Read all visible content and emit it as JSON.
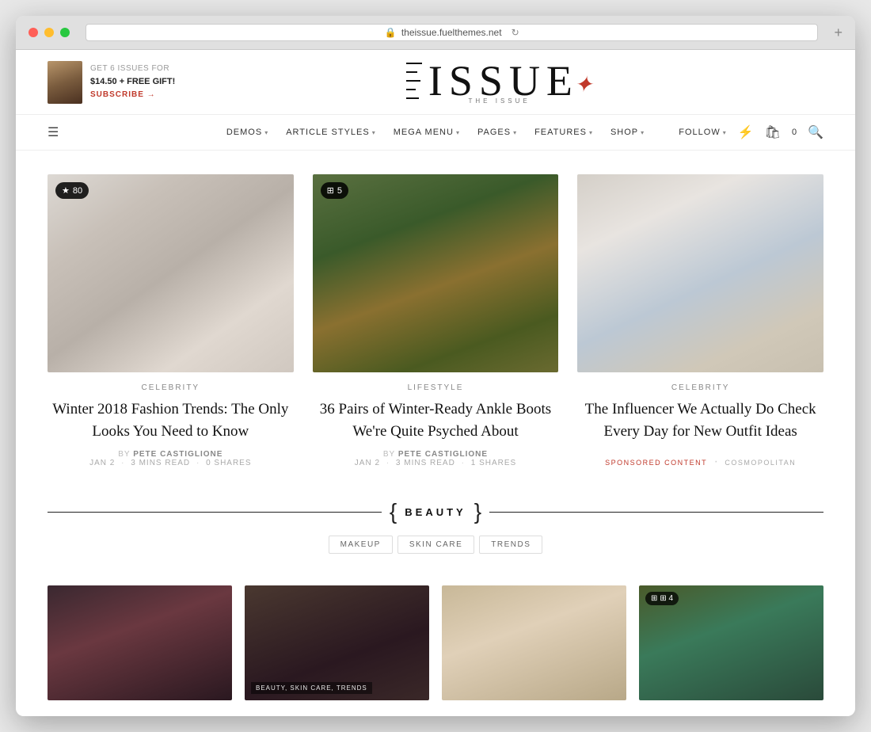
{
  "browser": {
    "url": "theissue.fuelthemes.net",
    "refresh_icon": "↻"
  },
  "top_bar": {
    "subscription": {
      "label": "GET 6 ISSUES FOR",
      "price": "$14.50 + FREE GIFT!",
      "link": "SUBSCRIBE →"
    }
  },
  "logo": {
    "subtitle": "THE ISSUE",
    "main": "ISSUE"
  },
  "nav": {
    "items": [
      {
        "label": "DEMOS",
        "has_dropdown": true
      },
      {
        "label": "ARTICLE STYLES",
        "has_dropdown": true
      },
      {
        "label": "MEGA MENU",
        "has_dropdown": true
      },
      {
        "label": "PAGES",
        "has_dropdown": true
      },
      {
        "label": "FEATURES",
        "has_dropdown": true
      },
      {
        "label": "SHOP",
        "has_dropdown": true
      }
    ],
    "right": {
      "follow": "FOLLOW",
      "cart_count": "0"
    }
  },
  "articles": [
    {
      "id": "article-1",
      "badge": "★ 80",
      "category": "CELEBRITY",
      "title": "Winter 2018 Fashion Trends: The Only Looks You Need to Know",
      "author_label": "BY",
      "author": "PETE CASTIGLIONE",
      "date": "JAN 2",
      "read_time": "3 MINS READ",
      "shares": "0 SHARES",
      "image_type": "fashion"
    },
    {
      "id": "article-2",
      "badge": "⊞ 5",
      "category": "LIFESTYLE",
      "title": "36 Pairs of Winter-Ready Ankle Boots We're Quite Psyched About",
      "author_label": "BY",
      "author": "PETE CASTIGLIONE",
      "date": "JAN 2",
      "read_time": "3 MINS READ",
      "shares": "1 SHARES",
      "image_type": "lifestyle"
    },
    {
      "id": "article-3",
      "badge": null,
      "category": "CELEBRITY",
      "title": "The Influencer We Actually Do Check Every Day for New Outfit Ideas",
      "sponsored_tag": "SPONSORED CONTENT",
      "sponsored_pub": "COSMOPOLITAN",
      "image_type": "celebrity"
    }
  ],
  "beauty_section": {
    "title": "BEAUTY",
    "left_brace": "{",
    "right_brace": "}",
    "tabs": [
      "MAKEUP",
      "SKIN CARE",
      "TRENDS"
    ]
  },
  "bottom_articles": [
    {
      "id": "bottom-1",
      "image_type": "dark-person",
      "badge": null,
      "tag": null
    },
    {
      "id": "bottom-2",
      "image_type": "dark-scene",
      "badge": null,
      "tag": "BEAUTY, SKIN CARE, TRENDS"
    },
    {
      "id": "bottom-3",
      "image_type": "light-fur",
      "badge": null,
      "tag": null
    },
    {
      "id": "bottom-4",
      "image_type": "dark-colorful",
      "badge": "⊞ 4",
      "tag": null
    }
  ]
}
